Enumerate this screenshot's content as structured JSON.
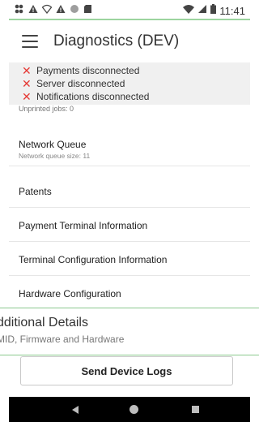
{
  "status_bar": {
    "time": "11:41",
    "left_icons": [
      "grid-icon",
      "alert-triangle-icon",
      "wifi-alert-icon",
      "alert-triangle-icon",
      "circle-icon",
      "sd-card-icon"
    ],
    "right_icons": [
      "wifi-icon",
      "signal-icon",
      "battery-icon"
    ]
  },
  "app_bar": {
    "title": "Diagnostics (DEV)"
  },
  "alerts": [
    {
      "text": "Payments disconnected"
    },
    {
      "text": "Server disconnected"
    },
    {
      "text": "Notifications disconnected"
    }
  ],
  "unprinted_jobs": "Unprinted jobs: 0",
  "list": [
    {
      "label": "Network Queue",
      "sub": "Network queue size: 11"
    },
    {
      "label": "Patents",
      "sub": ""
    },
    {
      "label": "Payment Terminal Information",
      "sub": ""
    },
    {
      "label": "Terminal Configuration Information",
      "sub": ""
    },
    {
      "label": "Hardware Configuration",
      "sub": ""
    }
  ],
  "floating_card": {
    "title": "dditional Details",
    "sub": "MID, Firmware and Hardware"
  },
  "send_button": {
    "label": "Send Device Logs"
  },
  "colors": {
    "alert_x": "#e53935",
    "accent_line": "#8bc98e",
    "nav_bg": "#000000"
  }
}
